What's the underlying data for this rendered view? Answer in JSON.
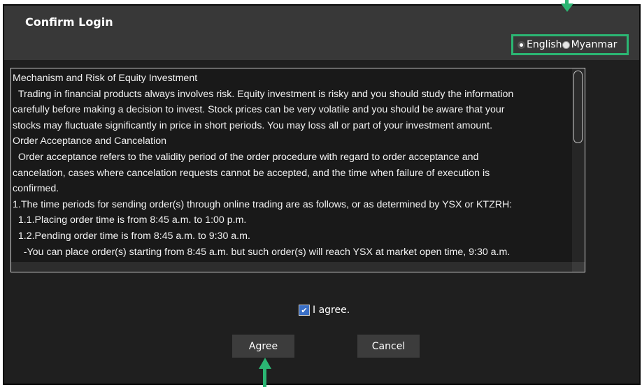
{
  "dialog": {
    "title": "Confirm Login"
  },
  "language": {
    "options": [
      {
        "label": "English",
        "selected": true
      },
      {
        "label": "Myanmar",
        "selected": false
      }
    ]
  },
  "terms": {
    "lines": [
      "Mechanism and Risk of Equity Investment",
      "  Trading in financial products always involves risk. Equity investment is risky and you should study the information",
      "carefully before making a decision to invest. Stock prices can be very volatile and you should be aware that your",
      "stocks may fluctuate significantly in price in short periods. You may loss all or part of your investment amount.",
      "Order Acceptance and Cancelation",
      "  Order acceptance refers to the validity period of the order procedure with regard to order acceptance and",
      "cancelation, cases where cancelation requests cannot be accepted, and the time when failure of execution is",
      "confirmed.",
      "1.The time periods for sending order(s) through online trading are as follows, or as determined by YSX or KTZRH:",
      "  1.1.Placing order time is from 8:45 a.m. to 1:00 p.m.",
      "  1.2.Pending order time is from 8:45 a.m. to 9:30 a.m.",
      "    -You can place order(s) starting from 8:45 a.m. but such order(s) will reach YSX at market open time, 9:30 a.m."
    ]
  },
  "agreement": {
    "checkbox_label": "I agree.",
    "checked": true
  },
  "buttons": {
    "agree": "Agree",
    "cancel": "Cancel"
  },
  "colors": {
    "highlight": "#2bb673",
    "dialog_bg": "#1f1f1f",
    "header_bg": "#383838"
  }
}
